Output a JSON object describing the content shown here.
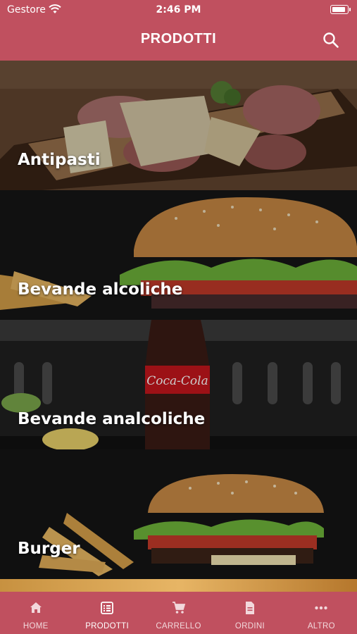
{
  "status_bar": {
    "carrier": "Gestore",
    "time": "2:46 PM"
  },
  "header": {
    "title": "PRODOTTI",
    "search_icon": "search-icon"
  },
  "categories": [
    {
      "label": "Antipasti"
    },
    {
      "label": "Bevande alcoliche"
    },
    {
      "label": "Bevande analcoliche"
    },
    {
      "label": "Burger"
    }
  ],
  "tabbar": {
    "active": "PRODOTTI",
    "items": [
      {
        "label": "HOME",
        "icon": "home-icon"
      },
      {
        "label": "PRODOTTI",
        "icon": "list-icon"
      },
      {
        "label": "CARRELLO",
        "icon": "cart-icon"
      },
      {
        "label": "ORDINI",
        "icon": "document-icon"
      },
      {
        "label": "ALTRO",
        "icon": "more-icon"
      }
    ]
  },
  "colors": {
    "primary": "#c0505f",
    "text_on_primary": "#ffffff"
  }
}
